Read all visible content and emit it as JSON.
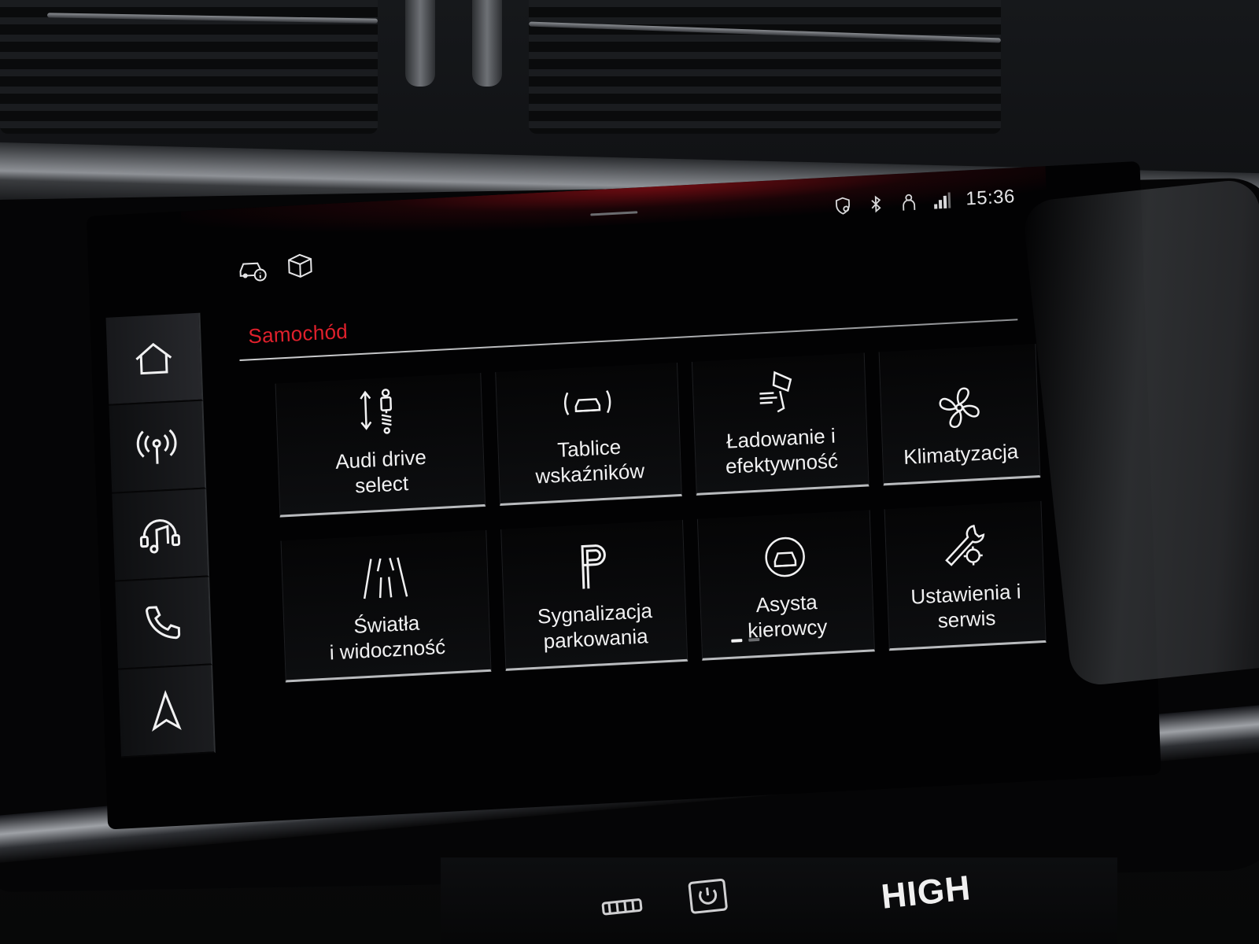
{
  "status_bar": {
    "time": "15:36",
    "icons": [
      "shield-location-icon",
      "bluetooth-icon",
      "person-icon",
      "signal-icon"
    ]
  },
  "top_icons": [
    "car-info-icon",
    "package-icon"
  ],
  "sidebar": {
    "items": [
      {
        "icon": "home-icon",
        "active": true
      },
      {
        "icon": "radio-icon",
        "active": false
      },
      {
        "icon": "music-icon",
        "active": false
      },
      {
        "icon": "phone-icon",
        "active": false
      },
      {
        "icon": "navigation-icon",
        "active": false
      }
    ]
  },
  "section": {
    "title": "Samochód"
  },
  "tiles": [
    {
      "label": "Audi drive\nselect",
      "icon": "suspension-icon"
    },
    {
      "label": "Tablice\nwskaźników",
      "icon": "car-dashboard-icon"
    },
    {
      "label": "Ładowanie i\nefektywność",
      "icon": "charging-efficiency-icon"
    },
    {
      "label": "Klimatyzacja",
      "icon": "fan-icon"
    },
    {
      "label": "Światła\ni widoczność",
      "icon": "lights-icon"
    },
    {
      "label": "Sygnalizacja\nparkowania",
      "icon": "parking-icon"
    },
    {
      "label": "Asysta\nkierowcy",
      "icon": "driver-assist-icon"
    },
    {
      "label": "Ustawienia i\nserwis",
      "icon": "wrench-gear-icon"
    }
  ],
  "pager": {
    "pages": 2,
    "current": 1
  },
  "console": {
    "mode_label": "HIGH"
  },
  "colors": {
    "accent": "#e0202c",
    "text": "#f1f1f2",
    "background": "#020203"
  }
}
